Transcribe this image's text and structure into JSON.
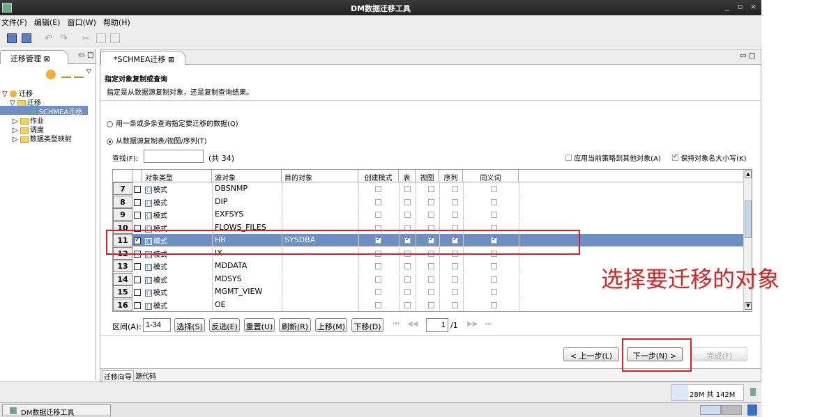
{
  "window": {
    "title": "DM数据迁移工具",
    "controls": [
      "_",
      "▫",
      "×"
    ]
  },
  "menu": [
    "文件(F)",
    "编辑(E)",
    "窗口(W)",
    "帮助(H)"
  ],
  "left_panel": {
    "tab_label": "迁移管理 ⊠",
    "tree": [
      {
        "label": "迁移",
        "level": 0,
        "expanded": "▽"
      },
      {
        "label": "迁移",
        "level": 1,
        "expanded": "▽"
      },
      {
        "label": "SCHMEA迁移",
        "level": 2,
        "selected": true
      },
      {
        "label": "作业",
        "level": 1,
        "expanded": "▷"
      },
      {
        "label": "调度",
        "level": 1,
        "expanded": "▷"
      },
      {
        "label": "数据类型映射",
        "level": 1,
        "expanded": "▷"
      }
    ]
  },
  "editor": {
    "tab_label": "*SCHMEA迁移 ⊠",
    "section_title": "指定对象复制或查询",
    "section_desc": "指定是从数据源复制对象，还是复制查询结果。",
    "radio_query": "用一条或多条查询指定要迁移的数据(Q)",
    "radio_copy": "从数据源复制表/视图/序列(T)",
    "find_label": "查找(F):",
    "find_value": "",
    "count_label": "(共 34)",
    "opt_apply": "应用当前策略到其他对象(A)",
    "opt_keepcase": "保持对象名大小写(K)",
    "columns": [
      "对象类型",
      "源对象",
      "目的对象",
      "创建模式",
      "表",
      "视图",
      "序列",
      "同义词"
    ],
    "rows": [
      {
        "num": "7",
        "checked": false,
        "type": "模式",
        "src": "DBSNMP",
        "dst": "",
        "create": false,
        "table": false,
        "view": false,
        "seq": false,
        "syn": false
      },
      {
        "num": "8",
        "checked": false,
        "type": "模式",
        "src": "DIP",
        "dst": "",
        "create": false,
        "table": false,
        "view": false,
        "seq": false,
        "syn": false
      },
      {
        "num": "9",
        "checked": false,
        "type": "模式",
        "src": "EXFSYS",
        "dst": "",
        "create": false,
        "table": false,
        "view": false,
        "seq": false,
        "syn": false
      },
      {
        "num": "10",
        "checked": false,
        "type": "模式",
        "src": "FLOWS_FILES",
        "dst": "",
        "create": false,
        "table": false,
        "view": false,
        "seq": false,
        "syn": false
      },
      {
        "num": "11",
        "checked": true,
        "type": "模式",
        "src": "HR",
        "dst": "SYSDBA",
        "create": true,
        "table": true,
        "view": true,
        "seq": true,
        "syn": true,
        "selected": true
      },
      {
        "num": "12",
        "checked": false,
        "type": "模式",
        "src": "IX",
        "dst": "",
        "create": false,
        "table": false,
        "view": false,
        "seq": false,
        "syn": false
      },
      {
        "num": "13",
        "checked": false,
        "type": "模式",
        "src": "MDDATA",
        "dst": "",
        "create": false,
        "table": false,
        "view": false,
        "seq": false,
        "syn": false
      },
      {
        "num": "14",
        "checked": false,
        "type": "模式",
        "src": "MDSYS",
        "dst": "",
        "create": false,
        "table": false,
        "view": false,
        "seq": false,
        "syn": false
      },
      {
        "num": "15",
        "checked": false,
        "type": "模式",
        "src": "MGMT_VIEW",
        "dst": "",
        "create": false,
        "table": false,
        "view": false,
        "seq": false,
        "syn": false
      },
      {
        "num": "16",
        "checked": false,
        "type": "模式",
        "src": "OE",
        "dst": "",
        "create": false,
        "table": false,
        "view": false,
        "seq": false,
        "syn": false
      }
    ],
    "range_label": "区间(A):",
    "range_value": "1-34",
    "buttons": {
      "select": "选择(S)",
      "invert": "反选(E)",
      "reset": "重置(U)",
      "refresh": "刷新(R)",
      "up": "上移(M)",
      "down": "下移(D)"
    },
    "page_value": "1",
    "page_total": "/1",
    "nav": {
      "back": "< 上一步(L)",
      "next": "下一步(N) >",
      "finish": "完成(F)"
    },
    "bottom_tabs": [
      "迁移向导",
      "源代码"
    ]
  },
  "status": {
    "memory": "28M 共 142M"
  },
  "taskbar": {
    "app": "DM数据迁移工具"
  },
  "annotation": "选择要迁移的对象",
  "colors": {
    "selected_row": "#6f8fc7",
    "annotation": "#e02020"
  }
}
